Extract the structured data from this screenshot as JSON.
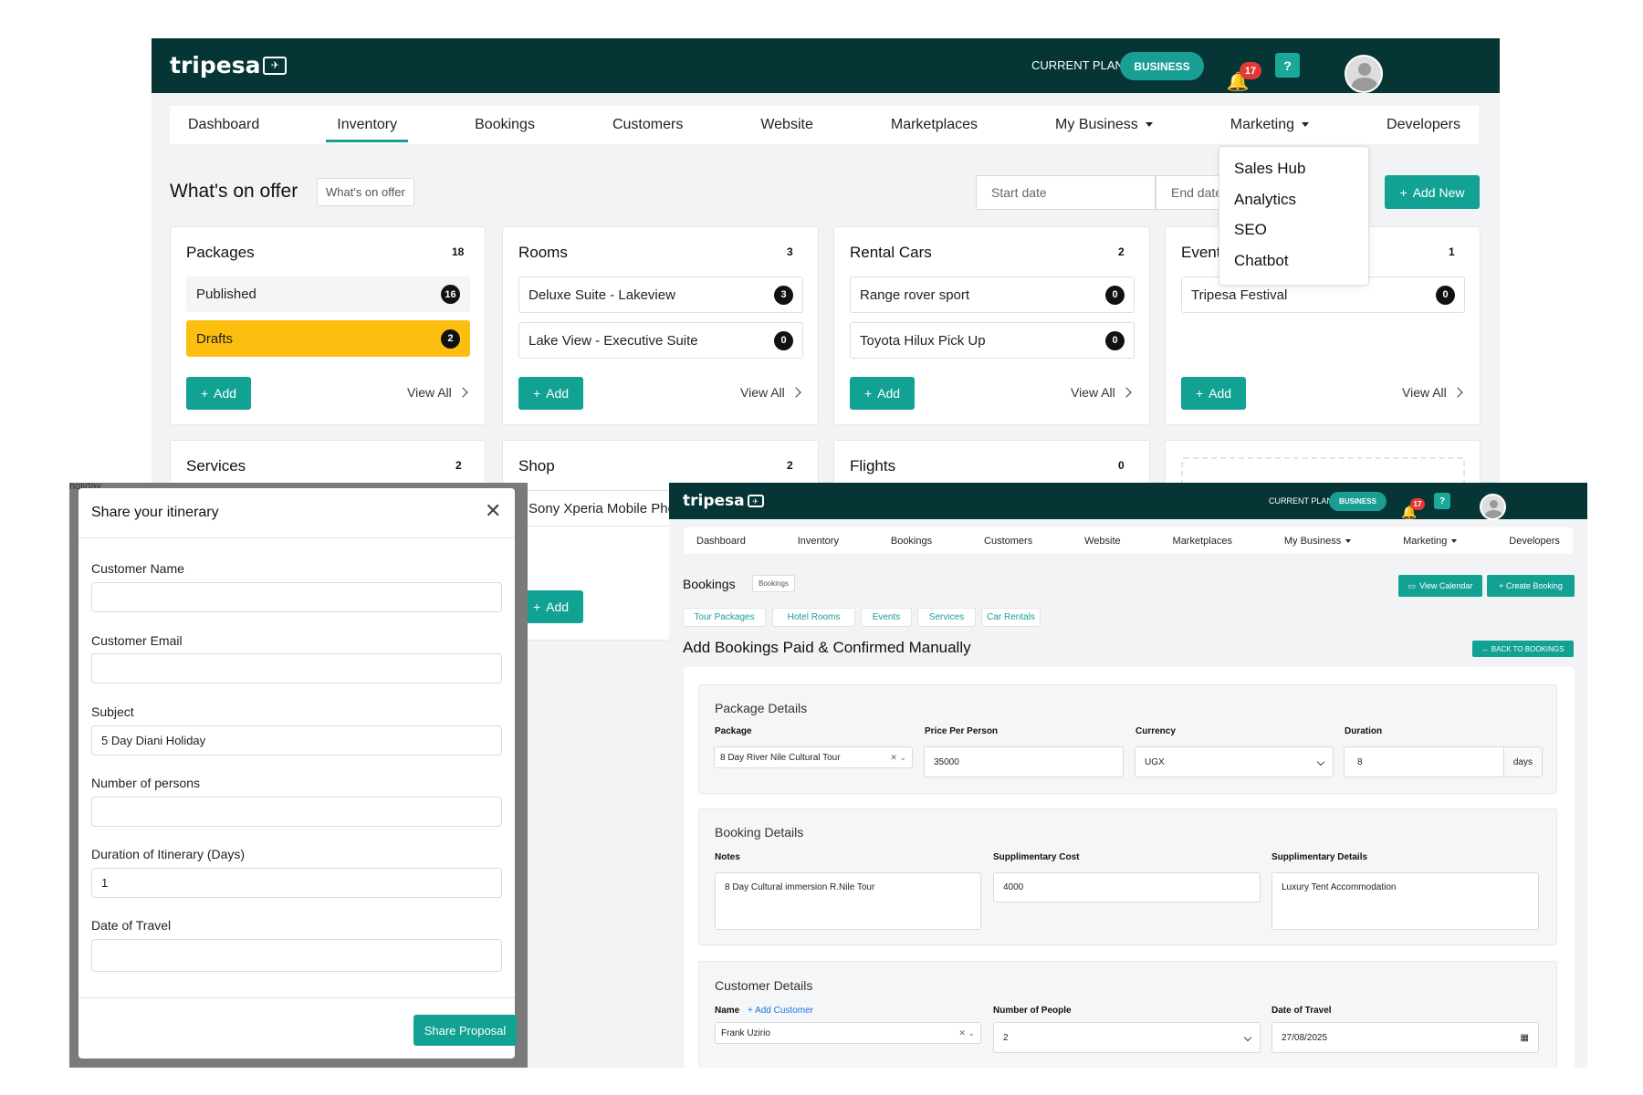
{
  "brand": {
    "name": "tripesa"
  },
  "header": {
    "plan_label": "CURRENT PLAN",
    "plan_name": "BUSINESS",
    "notification_count": "17",
    "help_label": "?"
  },
  "nav": {
    "items": [
      "Dashboard",
      "Inventory",
      "Bookings",
      "Customers",
      "Website",
      "Marketplaces",
      "My Business",
      "Marketing",
      "Developers"
    ],
    "active": "Inventory"
  },
  "marketing_menu": [
    "Sales Hub",
    "Analytics",
    "SEO",
    "Chatbot"
  ],
  "inventory_page": {
    "title": "What's on offer",
    "breadcrumb": "What's on offer",
    "start_date_placeholder": "Start date",
    "end_date_placeholder": "End date",
    "add_new_label": "Add New",
    "add_label": "Add",
    "view_all_label": "View All",
    "cards": [
      {
        "title": "Packages",
        "count": "18",
        "rows": [
          {
            "label": "Published",
            "count": "16"
          },
          {
            "label": "Drafts",
            "count": "2"
          }
        ]
      },
      {
        "title": "Rooms",
        "count": "3",
        "rows": [
          {
            "label": "Deluxe Suite - Lakeview",
            "count": "3"
          },
          {
            "label": "Lake View - Executive Suite",
            "count": "0"
          }
        ]
      },
      {
        "title": "Rental Cars",
        "count": "2",
        "rows": [
          {
            "label": "Range rover sport",
            "count": "0"
          },
          {
            "label": "Toyota Hilux Pick Up",
            "count": "0"
          }
        ]
      },
      {
        "title": "Events",
        "count": "1",
        "rows": [
          {
            "label": "Tripesa Festival",
            "count": "0"
          }
        ]
      }
    ],
    "cards_row2": [
      {
        "title": "Services",
        "count": "2"
      },
      {
        "title": "Shop",
        "count": "2",
        "item": "Sony Xperia Mobile Phone"
      },
      {
        "title": "Flights",
        "count": "0"
      }
    ],
    "colors": {
      "teal": "#12a293",
      "drafts": "#fcbf10",
      "topbar": "#063535"
    }
  },
  "share_modal": {
    "title": "Share your itinerary",
    "fields": [
      {
        "label": "Customer Name",
        "value": ""
      },
      {
        "label": "Customer Email",
        "value": ""
      },
      {
        "label": "Subject",
        "value": "5 Day Diani Holiday"
      },
      {
        "label": "Number of persons",
        "value": ""
      },
      {
        "label": "Duration of Itinerary (Days)",
        "value": "1"
      },
      {
        "label": "Date of Travel",
        "value": ""
      }
    ],
    "submit_label": "Share Proposal",
    "backdrop_text": "holiday"
  },
  "bookings_page": {
    "title": "Bookings",
    "breadcrumb": "Bookings",
    "view_calendar_label": "View Calendar",
    "create_booking_label": "+ Create Booking",
    "tabs": [
      "Tour Packages",
      "Hotel Rooms",
      "Events",
      "Services",
      "Car Rentals"
    ],
    "form_title": "Add Bookings Paid & Confirmed Manually",
    "back_label": "← BACK TO BOOKINGS",
    "package_details": {
      "title": "Package Details",
      "package_label": "Package",
      "package_value": "8 Day River Nile Cultural Tour",
      "price_label": "Price Per Person",
      "price_value": "35000",
      "currency_label": "Currency",
      "currency_value": "UGX",
      "duration_label": "Duration",
      "duration_value": "8",
      "duration_unit": "days"
    },
    "booking_details": {
      "title": "Booking Details",
      "notes_label": "Notes",
      "notes_value": "8 Day Cultural immersion R.Nile Tour",
      "supp_cost_label": "Supplimentary Cost",
      "supp_cost_value": "4000",
      "supp_details_label": "Supplimentary Details",
      "supp_details_value": "Luxury Tent Accommodation"
    },
    "customer_details": {
      "title": "Customer Details",
      "name_label": "Name",
      "add_customer_label": "+ Add Customer",
      "name_value": "Frank Uzirio",
      "people_label": "Number of People",
      "people_value": "2",
      "date_label": "Date of Travel",
      "date_value": "27/08/2025"
    }
  }
}
